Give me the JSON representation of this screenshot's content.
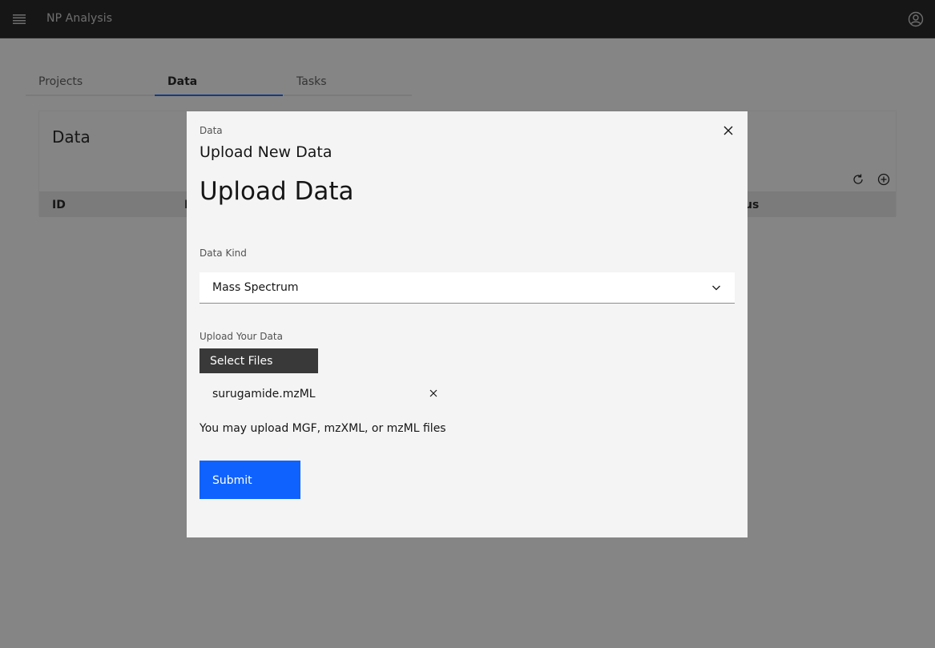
{
  "header": {
    "menu_icon": "hamburger-menu-icon",
    "app_title": "NP Analysis",
    "user_icon": "user-avatar-icon"
  },
  "tabs": [
    {
      "label": "Projects",
      "active": false
    },
    {
      "label": "Data",
      "active": true
    },
    {
      "label": "Tasks",
      "active": false
    }
  ],
  "table": {
    "title": "Data",
    "toolbar": {
      "refresh_icon": "refresh-icon",
      "add_icon": "add-circle-icon"
    },
    "columns_visible": [
      "ID",
      "N",
      "us"
    ]
  },
  "modal": {
    "label": "Data",
    "heading": "Upload New Data",
    "close_icon": "close-icon",
    "form_title": "Upload Data",
    "data_kind": {
      "label": "Data Kind",
      "selected": "Mass Spectrum",
      "chevron_icon": "chevron-down-icon"
    },
    "upload": {
      "label": "Upload Your Data",
      "button_label": "Select Files",
      "files": [
        {
          "name": "surugamide.mzML"
        }
      ],
      "helper_text": "You may upload MGF, mzXML, or mzML files"
    },
    "submit_label": "Submit"
  },
  "colors": {
    "accent": "#0f62fe",
    "header_bg": "#161616",
    "modal_bg": "#f4f4f4"
  }
}
